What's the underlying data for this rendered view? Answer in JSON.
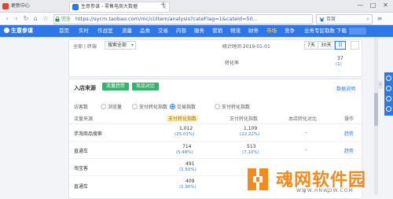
{
  "browser": {
    "tabs": [
      {
        "label": "更新中心",
        "color": "#e0442f"
      },
      {
        "label": "生意参谋 - 零售电商大数据",
        "color": "#2f76e6"
      }
    ],
    "window_buttons": [
      "—",
      "□",
      "✕"
    ],
    "security_label": "完全",
    "url": "https://sycm.taobao.com/mc/ci/item/analysis?cateFlag=1&cateId=50...",
    "search_engine": "百度"
  },
  "topnav": {
    "brand": "生意参谋",
    "items": [
      "首页",
      "实时",
      "作战室",
      "流量",
      "品类",
      "交易",
      "内容",
      "服务",
      "营销",
      "物流",
      "财务",
      "市场",
      "竞争",
      "业务专区",
      "取数",
      "学院",
      "下载"
    ],
    "active_index": 11
  },
  "top_panel": {
    "filter_label": "全部 | 终端",
    "filter_value": "搜索全部",
    "date_label": "统计时间 2019-01-01",
    "range_buttons": [
      "7天",
      "30天",
      "日"
    ],
    "range_active_index": 2,
    "rate_label": "转化率",
    "value": "37",
    "value_pct": "(1)",
    "dash": "-"
  },
  "main_panel": {
    "title": "入店来源",
    "buttons": [
      "流量趋势",
      "竞品对比"
    ],
    "view_link": "数据说明",
    "filters": [
      "访客数",
      "浏览量",
      "支付转化指数",
      "交易指数",
      "支付转化指数"
    ],
    "checked_filter_index": 3,
    "columns": [
      "流量来源",
      "支付转化指数",
      "支付转化指数",
      "本店转化对比",
      "操作"
    ],
    "rows": [
      {
        "source": "手淘商品搜索",
        "v1": "1,012",
        "p1": "(25.01%)",
        "v2": "1,109",
        "p2": "(22.22%)",
        "dash": "-",
        "op": "趋势"
      },
      {
        "source": "直通车",
        "v1": "714",
        "p1": "(5.48%)",
        "v2": "513",
        "p2": "(7.10%)",
        "dash": "-",
        "op": "趋势"
      },
      {
        "source": "淘宝客",
        "v1": "491",
        "p1": "(1.50%)",
        "v2": "",
        "p2": "",
        "dash": "",
        "op": ""
      },
      {
        "source": "直通车",
        "v1": "409",
        "p1": "(1.90%)",
        "v2": "",
        "p2": "",
        "dash": "",
        "op": ""
      }
    ]
  },
  "side_tools": [
    "chat-icon",
    "phone-icon",
    "feedback-icon",
    "top-icon"
  ],
  "watermark": {
    "title": "魂网软件园",
    "url": "WWW.HNWDW.COM"
  },
  "bottom_nav": {
    "prev": "‹",
    "next": "›"
  }
}
